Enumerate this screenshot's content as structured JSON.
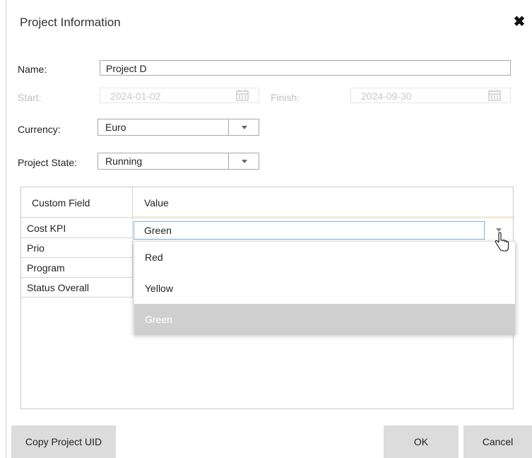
{
  "dialog": {
    "title": "Project Information",
    "close_glyph": "✖"
  },
  "form": {
    "name_label": "Name:",
    "name_value": "Project D",
    "start_label": "Start:",
    "start_value": "2024-01-02",
    "finish_label": "Finish:",
    "finish_value": "2024-09-30",
    "currency_label": "Currency:",
    "currency_value": "Euro",
    "state_label": "Project State:",
    "state_value": "Running",
    "calendar_icon": "calendar-icon"
  },
  "grid": {
    "columns": [
      "Custom Field",
      "Value"
    ],
    "rows": [
      "Cost KPI",
      "Prio",
      "Program",
      "Status Overall"
    ],
    "active_value": "Green",
    "dropdown_options": [
      "Red",
      "Yellow",
      "Green"
    ],
    "selected_option": "Green"
  },
  "buttons": {
    "copy_uid": "Copy Project UID",
    "ok": "OK",
    "cancel": "Cancel"
  },
  "colors": {
    "selected_option_bg": "#cfcfcf",
    "active_input_border": "#7fb2de",
    "button_bg": "#dcdcdc"
  }
}
